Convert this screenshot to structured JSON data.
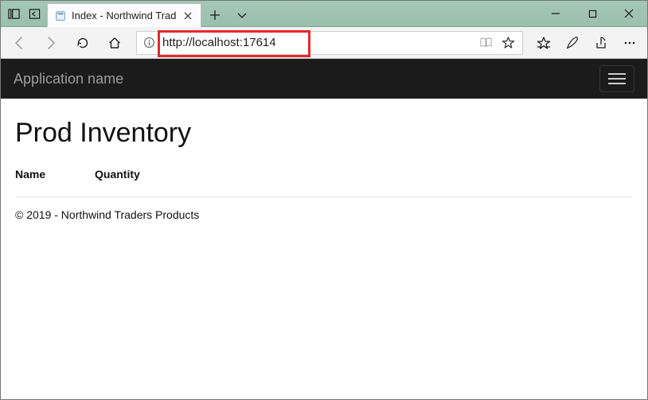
{
  "titlebar": {
    "tab_title": "Index - Northwind Trad"
  },
  "address": {
    "url": "http://localhost:17614"
  },
  "navbar": {
    "brand": "Application name"
  },
  "page": {
    "heading": "Prod Inventory",
    "columns": [
      "Name",
      "Quantity"
    ],
    "footer": "© 2019 - Northwind Traders Products"
  }
}
